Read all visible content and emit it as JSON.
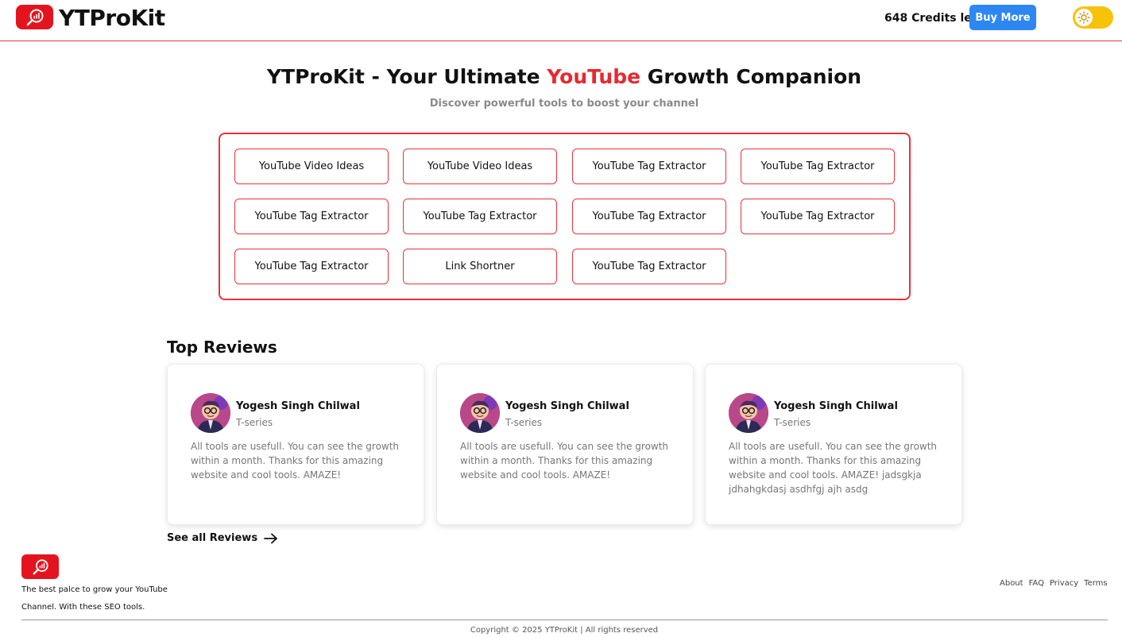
{
  "header": {
    "brand": "YTProKit",
    "credits": "648 Credits left",
    "buy_label": "Buy More",
    "toggle_icon": "sun-icon"
  },
  "hero": {
    "title_part1": "YTProKit - Your Ultimate ",
    "title_highlight": "YouTube",
    "title_part2": " Growth Companion",
    "subtitle": "Discover powerful tools to boost your channel"
  },
  "tools": [
    "YouTube Video Ideas",
    "YouTube Video Ideas",
    "YouTube Tag Extractor",
    "YouTube Tag Extractor",
    "YouTube Tag Extractor",
    "YouTube Tag Extractor",
    "YouTube Tag Extractor",
    "YouTube Tag Extractor",
    "YouTube Tag Extractor",
    "Link Shortner",
    "YouTube Tag Extractor"
  ],
  "reviews": {
    "title": "Top Reviews",
    "items": [
      {
        "name": "Yogesh Singh Chilwal",
        "channel": "T-series",
        "text": "All tools are usefull. You can see the growth within a month. Thanks for this amazing website and cool tools. AMAZE!"
      },
      {
        "name": "Yogesh Singh Chilwal",
        "channel": "T-series",
        "text": "All tools are usefull. You can see the growth within a month. Thanks for this amazing website and cool tools. AMAZE!"
      },
      {
        "name": "Yogesh Singh Chilwal",
        "channel": "T-series",
        "text": "All tools are usefull. You can see the growth within a month. Thanks for this amazing website and cool tools. AMAZE! jadsgkja jdhahgkdasj asdhfgj ajh asdg"
      }
    ],
    "see_all": "See all Reviews"
  },
  "footer": {
    "tagline": "The best palce to grow your YouTube Channel. With these SEO tools.",
    "links": [
      "About",
      "FAQ",
      "Privacy",
      "Terms"
    ],
    "copyright": "Copyright © 2025 YTProKit | All rights reserved"
  },
  "colors": {
    "brand_red": "#e4141f",
    "accent_blue": "#2d87f3",
    "toggle_yellow": "#f7c20a"
  }
}
